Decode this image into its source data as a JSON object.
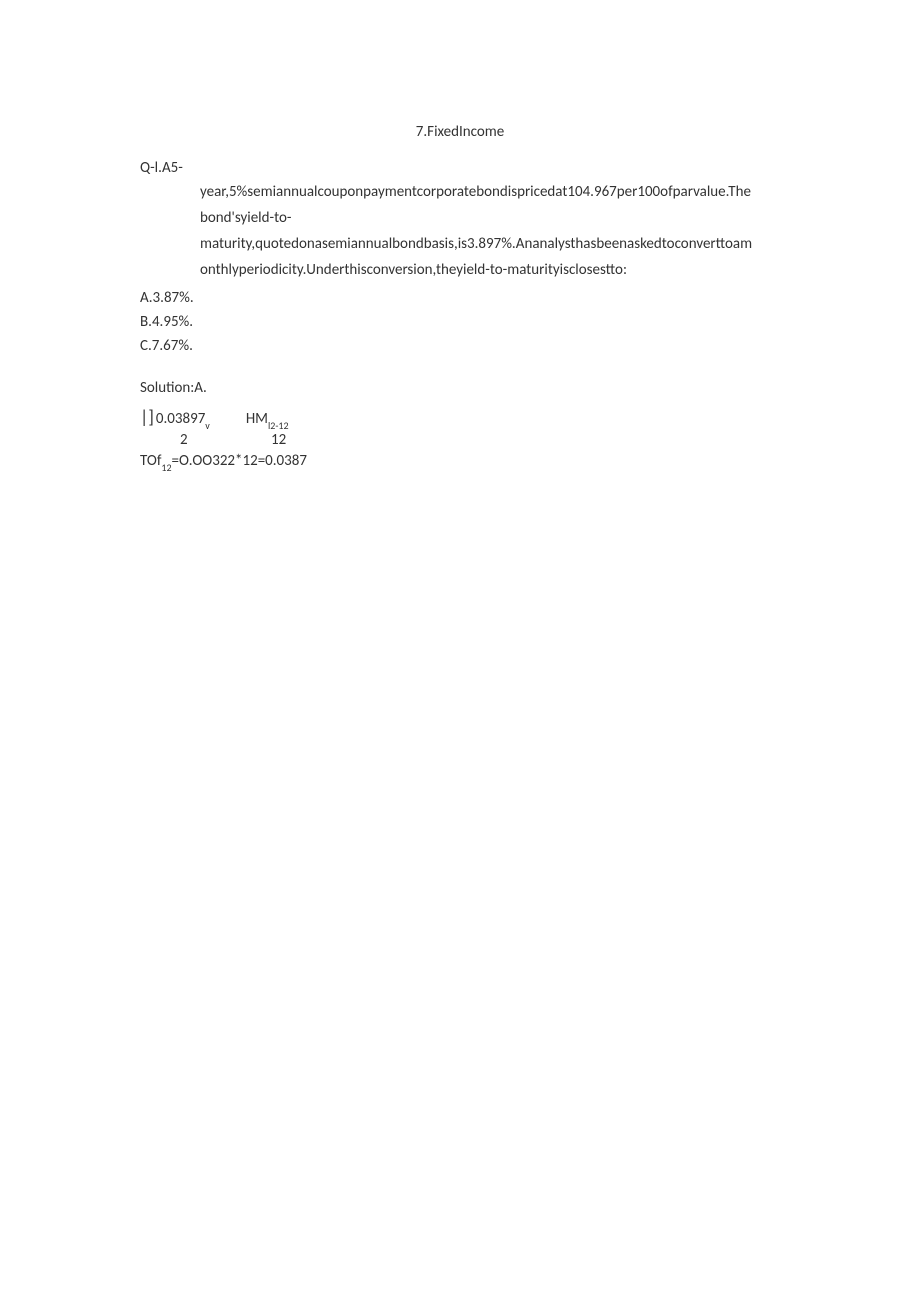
{
  "title": "7.FixedIncome",
  "question": {
    "prefix": "Q-l.A5-",
    "body1": "year,5%semiannualcouponpaymentcorporatebondispricedat104.967per100ofparvalue.The",
    "body2": "bond'syield-to-",
    "body3": "maturity,quotedonasemiannualbondbasis,is3.897%.Ananalysthasbeenaskedtoconverttoam",
    "body4": "onthlyperiodicity.Underthisconversion,theyield-to-maturityisclosestto:"
  },
  "options": {
    "a": "A.3.87%.",
    "b": "B.4.95%.",
    "c": "C.7.67%."
  },
  "solution": "Solution:A.",
  "formula": {
    "bracket": "|  ]",
    "val1": "0.03897",
    "sub1": "v",
    "hm": "HM",
    "hmsub": "l2-12",
    "line2a": "2",
    "line2b": "12",
    "line3p1": "TOf",
    "line3sub": "12",
    "line3p2": "=O.OO322*12=0.0387"
  }
}
